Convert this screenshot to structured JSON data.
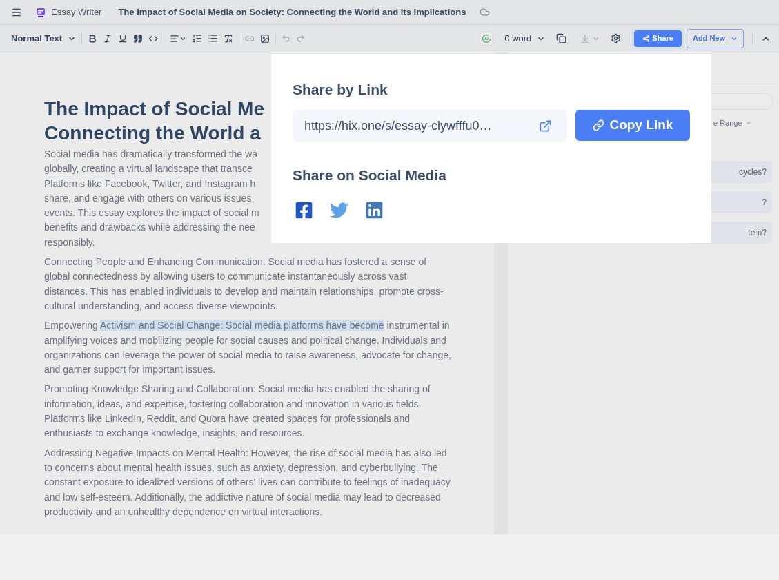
{
  "header": {
    "app_name": "Essay Writer",
    "document_title": "The Impact of Social Media on Society: Connecting the World and its Implications"
  },
  "toolbar": {
    "text_style": "Normal Text",
    "word_count": "0 word",
    "share_button": "Share",
    "add_new_button": "Add New"
  },
  "editor": {
    "title_lines": [
      "The Impact of Social Me",
      "Connecting the World a"
    ],
    "intro_lines": [
      "Social media has dramatically transformed the wa",
      "globally, creating a virtual landscape that transce",
      "Platforms like Facebook, Twitter, and Instagram h",
      "share, and engage with others on various issues,",
      "events. This essay explores the impact of social m",
      "benefits and drawbacks while addressing the nee",
      "responsibly."
    ],
    "paragraphs": [
      {
        "segments": [
          {
            "text": "Connecting People and Enhancing Communication: Social media has fostered a sense of global connectedness by allowing users to communicate instantaneously across vast distances. This has enabled individuals to develop and maintain relationships, promote cross-cultural understanding, and access diverse viewpoints.",
            "highlighted": false
          }
        ]
      },
      {
        "segments": [
          {
            "text": "Empowering ",
            "highlighted": false
          },
          {
            "text": "Activism and Social Change: Social media platforms have become",
            "highlighted": true
          },
          {
            "text": " instrumental in amplifying voices and mobilizing people for social causes and political change. Individuals and organizations can leverage the power of social media to raise awareness, advocate for change, and garner support for important issues.",
            "highlighted": false
          }
        ]
      },
      {
        "segments": [
          {
            "text": "Promoting Knowledge Sharing and Collaboration: Social media has enabled the sharing of information, ideas, and expertise, fostering collaboration and innovation in various fields. Platforms like LinkedIn, Reddit, and Quora have created spaces for professionals and enthusiasts to exchange knowledge, insights, and resources.",
            "highlighted": false
          }
        ]
      },
      {
        "segments": [
          {
            "text": "Addressing Negative Impacts on Mental Health: However, the rise of social media has also led to concerns about mental health issues, such as anxiety, depression, and cyberbullying. The constant exposure to idealized versions of others' lives can contribute to feelings of inadequacy and low self-esteem. Additionally, the addictive nature of social media may lead to decreased productivity and an unhealthy dependence on virtual interactions.",
            "highlighted": false
          }
        ]
      }
    ]
  },
  "side_panel": {
    "range_dropdown": "e Range",
    "questions": [
      "cycles?",
      "?",
      "tem?"
    ]
  },
  "share_popover": {
    "link_heading": "Share by Link",
    "link_url": "https://hix.one/s/essay-clywfffu0…",
    "copy_button": "Copy Link",
    "social_heading": "Share on Social Media",
    "social_links": [
      {
        "kind": "facebook"
      },
      {
        "kind": "twitter"
      },
      {
        "kind": "linkedin"
      }
    ]
  }
}
